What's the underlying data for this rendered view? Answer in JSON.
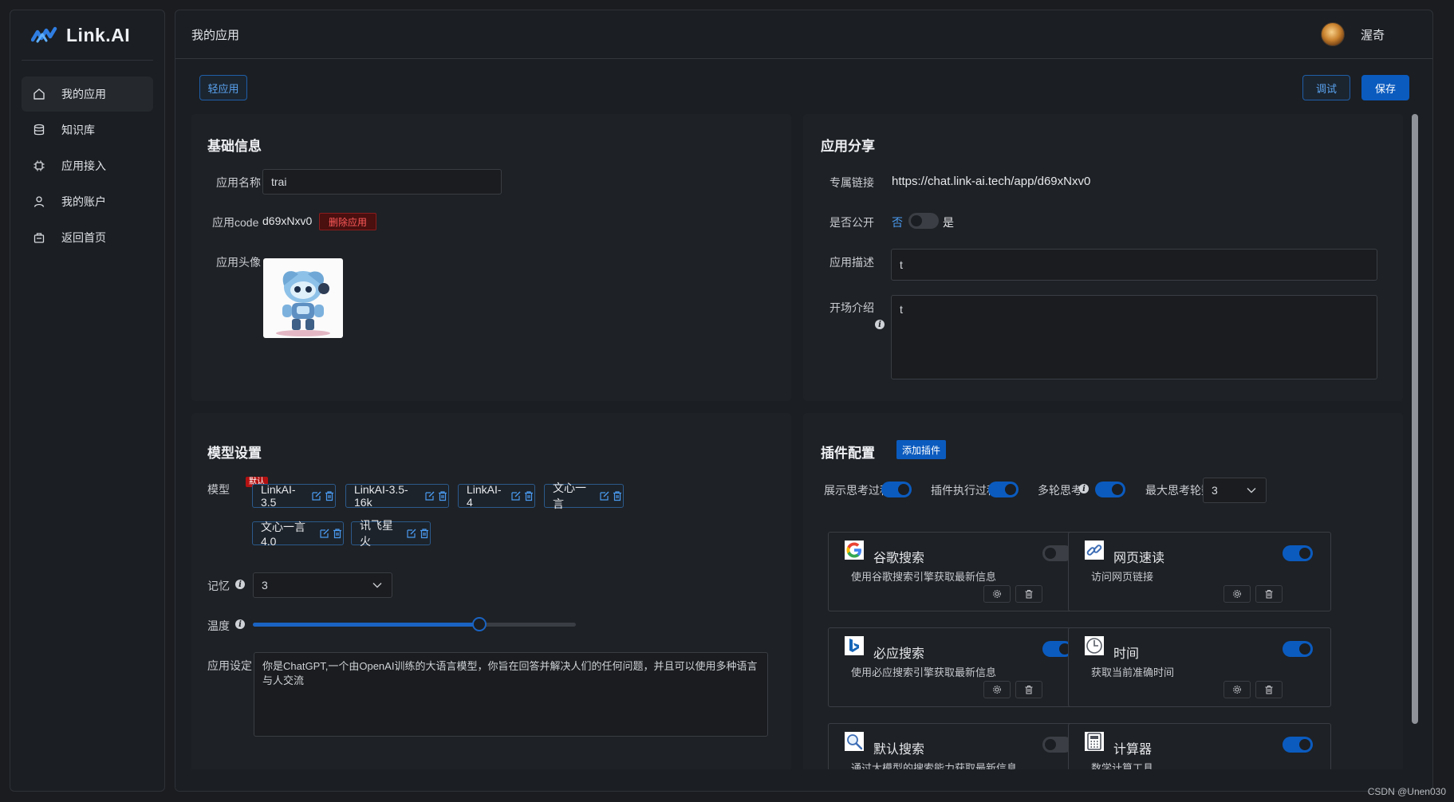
{
  "brand": {
    "name": "Link.AI"
  },
  "nav": [
    {
      "label": "我的应用",
      "icon": "home-icon",
      "active": true
    },
    {
      "label": "知识库",
      "icon": "database-icon"
    },
    {
      "label": "应用接入",
      "icon": "chip-icon"
    },
    {
      "label": "我的账户",
      "icon": "user-icon"
    },
    {
      "label": "返回首页",
      "icon": "bag-icon"
    }
  ],
  "header": {
    "title": "我的应用",
    "user_name": "渥奇"
  },
  "toolbar": {
    "light_app": "轻应用",
    "debug": "调试",
    "save": "保存"
  },
  "basic": {
    "title": "基础信息",
    "name_label": "应用名称",
    "name_value": "trai",
    "code_label": "应用code",
    "code_value": "d69xNxv0",
    "delete_label": "删除应用",
    "avatar_label": "应用头像"
  },
  "share": {
    "title": "应用分享",
    "link_label": "专属链接",
    "link_value": "https://chat.link-ai.tech/app/d69xNxv0",
    "public_label": "是否公开",
    "no": "否",
    "yes": "是",
    "public_on": false,
    "desc_label": "应用描述",
    "desc_value": "t",
    "intro_label": "开场介绍",
    "intro_value": "t"
  },
  "model": {
    "title": "模型设置",
    "model_label": "模型",
    "default_badge": "默认",
    "tags": [
      "LinkAI-3.5",
      "LinkAI-3.5-16k",
      "LinkAI-4",
      "文心一言",
      "文心一言4.0",
      "讯飞星火"
    ],
    "memory_label": "记忆",
    "memory_value": "3",
    "temp_label": "温度",
    "temp_value": 0.7,
    "prompt_label": "应用设定",
    "prompt_value": "你是ChatGPT,一个由OpenAI训练的大语言模型，你旨在回答并解决人们的任何问题，并且可以使用多种语言与人交流"
  },
  "plugins": {
    "title": "插件配置",
    "add_label": "添加插件",
    "show_thought_label": "展示思考过程",
    "show_thought_on": true,
    "exec_label": "插件执行过程",
    "exec_on": true,
    "multi_label": "多轮思考",
    "multi_on": true,
    "max_label": "最大思考轮数",
    "max_value": "3",
    "items": [
      {
        "name": "谷歌搜索",
        "desc": "使用谷歌搜索引擎获取最新信息",
        "icon": "google-icon",
        "on": false
      },
      {
        "name": "网页速读",
        "desc": "访问网页链接",
        "icon": "link-icon",
        "on": true
      },
      {
        "name": "必应搜索",
        "desc": "使用必应搜索引擎获取最新信息",
        "icon": "bing-icon",
        "on": true
      },
      {
        "name": "时间",
        "desc": "获取当前准确时间",
        "icon": "clock-icon",
        "on": true
      },
      {
        "name": "默认搜索",
        "desc": "通过大模型的搜索能力获取最新信息",
        "icon": "magnifier-icon",
        "on": false
      },
      {
        "name": "计算器",
        "desc": "数学计算工具",
        "icon": "calculator-icon",
        "on": true
      }
    ]
  },
  "watermark": "CSDN @Unen030"
}
